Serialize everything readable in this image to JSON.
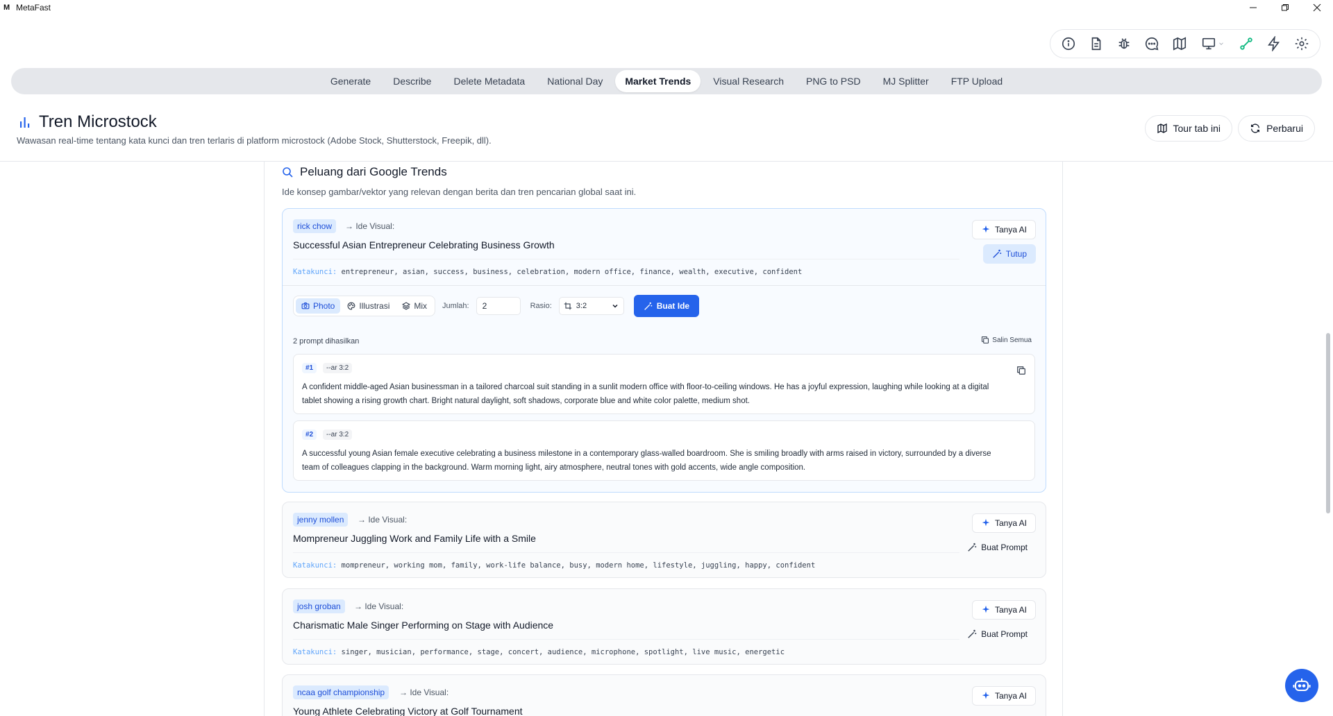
{
  "app": {
    "title": "MetaFast",
    "logo": "M"
  },
  "window_controls": [
    "minimize-icon",
    "restore-icon",
    "close-icon"
  ],
  "top_icons": [
    "info-icon",
    "document-icon",
    "bug-icon",
    "chat-icon",
    "map-icon",
    "monitor-icon",
    "link-icon",
    "lightning-icon",
    "gear-icon"
  ],
  "tabs": [
    "Generate",
    "Describe",
    "Delete Metadata",
    "National Day",
    "Market Trends",
    "Visual Research",
    "PNG to PSD",
    "MJ Splitter",
    "FTP Upload"
  ],
  "active_tab": "Market Trends",
  "header": {
    "title": "Tren Microstock",
    "subtitle": "Wawasan real-time tentang kata kunci dan tren terlaris di platform microstock (Adobe Stock, Shutterstock, Freepik, dll).",
    "tour_label": "Tour tab ini",
    "refresh_label": "Perbarui"
  },
  "section": {
    "title": "Peluang dari Google Trends",
    "subtitle": "Ide konsep gambar/vektor yang relevan dengan berita dan tren pencarian global saat ini."
  },
  "labels": {
    "ide_visual": "→ Ide Visual:",
    "keywords": "Katakunci:",
    "ask_ai": "Tanya AI",
    "close": "Tutup",
    "make_prompt": "Buat Prompt",
    "modes": [
      "Photo",
      "Illustrasi",
      "Mix"
    ],
    "amount": "Jumlah:",
    "amount_value": "2",
    "ratio": "Rasio:",
    "ratio_value": "3:2",
    "generate": "Buat Ide",
    "generated_count": "2 prompt dihasilkan",
    "copy_all": "Salin Semua"
  },
  "cards": [
    {
      "tag": "rick chow",
      "title": "Successful Asian Entrepreneur Celebrating Business Growth",
      "keywords": "entrepreneur, asian, success, business, celebration, modern office, finance, wealth, executive, confident"
    },
    {
      "tag": "jenny mollen",
      "title": "Mompreneur Juggling Work and Family Life with a Smile",
      "keywords": "mompreneur, working mom, family, work-life balance, busy, modern home, lifestyle, juggling, happy, confident"
    },
    {
      "tag": "josh groban",
      "title": "Charismatic Male Singer Performing on Stage with Audience",
      "keywords": "singer, musician, performance, stage, concert, audience, microphone, spotlight, live music, energetic"
    },
    {
      "tag": "ncaa golf championship",
      "title": "Young Athlete Celebrating Victory at Golf Tournament"
    }
  ],
  "prompts": [
    {
      "num": "#1",
      "ar": "--ar 3:2",
      "text": "A confident middle-aged Asian businessman in a tailored charcoal suit standing in a sunlit modern office with floor-to-ceiling windows. He has a joyful expression, laughing while looking at a digital tablet showing a rising growth chart. Bright natural daylight, soft shadows, corporate blue and white color palette, medium shot."
    },
    {
      "num": "#2",
      "ar": "--ar 3:2",
      "text": "A successful young Asian female executive celebrating a business milestone in a contemporary glass-walled boardroom. She is smiling broadly with arms raised in victory, surrounded by a diverse team of colleagues clapping in the background. Warm morning light, airy atmosphere, neutral tones with gold accents, wide angle composition."
    }
  ],
  "colors": {
    "accent": "#2563eb",
    "tag_bg": "#dbeafe",
    "tag_fg": "#1d4ed8"
  }
}
